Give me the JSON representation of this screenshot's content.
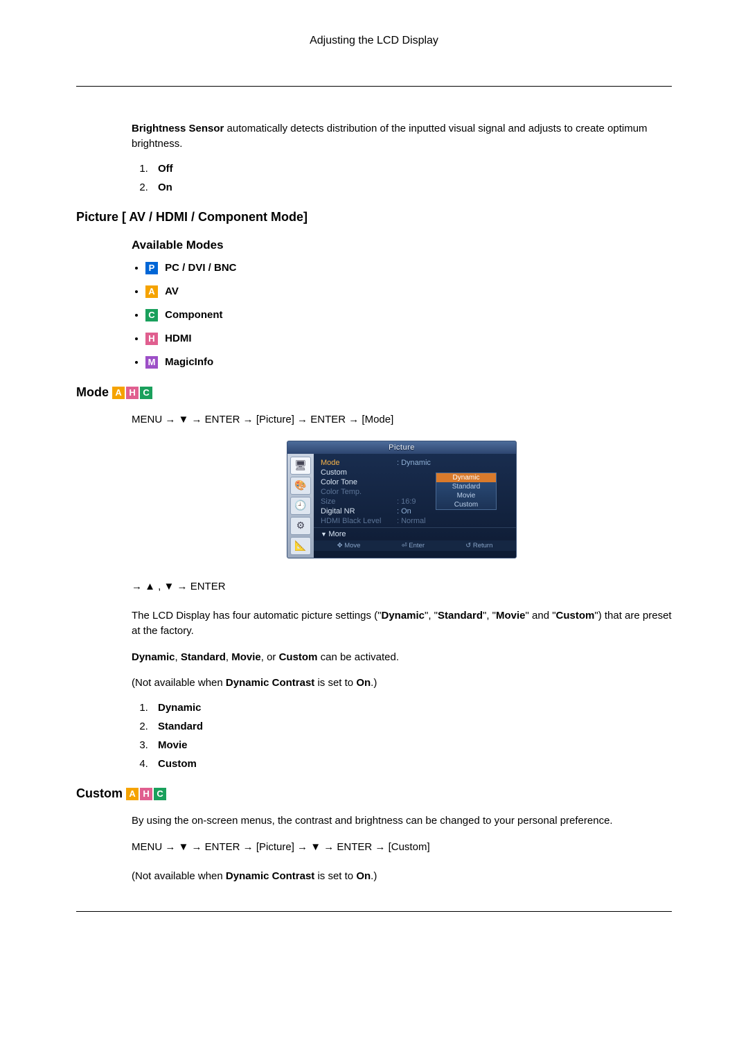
{
  "header": {
    "title": "Adjusting the LCD Display"
  },
  "brightness_sensor": {
    "lead_bold": "Brightness Sensor",
    "lead_rest": " automatically detects distribution of the inputted visual signal and adjusts to create optimum brightness.",
    "options": [
      "Off",
      "On"
    ]
  },
  "picture_section": {
    "heading": "Picture [ AV / HDMI / Component Mode]",
    "available_heading": "Available Modes",
    "modes": [
      {
        "badge": "P",
        "label": "PC / DVI / BNC"
      },
      {
        "badge": "A",
        "label": "AV"
      },
      {
        "badge": "C",
        "label": "Component"
      },
      {
        "badge": "H",
        "label": "HDMI"
      },
      {
        "badge": "M",
        "label": "MagicInfo"
      }
    ]
  },
  "mode_section": {
    "heading": "Mode",
    "badges": [
      "A",
      "H",
      "C"
    ],
    "nav1_prefix": "MENU → ▼ → ENTER → ",
    "nav1_tag1": "[Picture]",
    "nav1_mid": " → ENTER → ",
    "nav1_tag2": "[Mode]",
    "nav2": "→ ▲ , ▼ → ENTER",
    "para1_a": "The LCD Display has four automatic picture settings (\"",
    "para1_b": "Dynamic",
    "para1_c": "\", \"",
    "para1_d": "Standard",
    "para1_e": "\", \"",
    "para1_f": "Movie",
    "para1_g": "\" and \"",
    "para1_h": "Custom",
    "para1_i": "\") that are preset at the factory.",
    "para2_a": "Dynamic",
    "para2_b": ", ",
    "para2_c": "Standard",
    "para2_d": ", ",
    "para2_e": "Movie",
    "para2_f": ", or ",
    "para2_g": "Custom",
    "para2_h": " can be activated.",
    "note_a": "(Not available when ",
    "note_b": "Dynamic Contrast",
    "note_c": " is set to ",
    "note_d": "On",
    "note_e": ".)",
    "options": [
      "Dynamic",
      "Standard",
      "Movie",
      "Custom"
    ]
  },
  "osd": {
    "title": "Picture",
    "rows": [
      {
        "label": "Mode",
        "value": ": Dynamic",
        "highlight": true
      },
      {
        "label": "Custom",
        "value": ""
      },
      {
        "label": "Color Tone",
        "value": ""
      },
      {
        "label": "Color Temp.",
        "value": "",
        "dim": true
      },
      {
        "label": "Size",
        "value": ": 16:9",
        "dim": true
      },
      {
        "label": "Digital NR",
        "value": ": On"
      },
      {
        "label": "HDMI Black Level",
        "value": ": Normal",
        "dim": true
      }
    ],
    "more": "More",
    "popup": [
      "Dynamic",
      "Standard",
      "Movie",
      "Custom"
    ],
    "popup_selected": 0,
    "footer": {
      "move": "Move",
      "enter": "Enter",
      "return": "Return"
    }
  },
  "custom_section": {
    "heading": "Custom",
    "badges": [
      "A",
      "H",
      "C"
    ],
    "para": "By using the on-screen menus, the contrast and brightness can be changed to your personal preference.",
    "nav_prefix": "MENU → ▼ → ENTER → ",
    "nav_tag1": "[Picture]",
    "nav_mid": " → ▼ → ENTER → ",
    "nav_tag2": "[Custom]",
    "note_a": "(Not available when ",
    "note_b": "Dynamic Contrast",
    "note_c": " is set to ",
    "note_d": "On",
    "note_e": ".)"
  },
  "badge_colors": {
    "P": "badge-p",
    "A": "badge-a",
    "C": "badge-c",
    "H": "badge-h",
    "M": "badge-m"
  }
}
